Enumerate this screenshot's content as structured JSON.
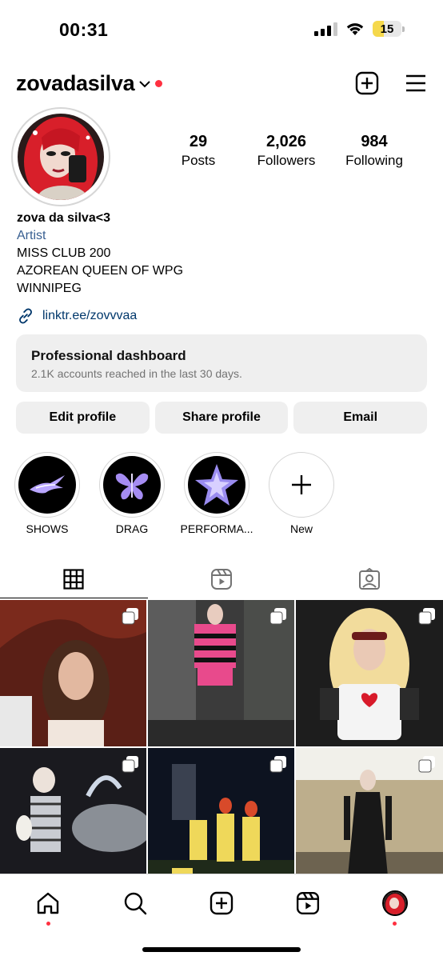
{
  "status_bar": {
    "time": "00:31",
    "battery": "15"
  },
  "header": {
    "username": "zovadasilva"
  },
  "profile": {
    "stats": [
      {
        "number": "29",
        "label": "Posts"
      },
      {
        "number": "2,026",
        "label": "Followers"
      },
      {
        "number": "984",
        "label": "Following"
      }
    ],
    "name": "zova da silva<3",
    "category": "Artist",
    "bio_lines": [
      "MISS CLUB 200",
      "AZOREAN QUEEN OF WPG",
      "WINNIPEG"
    ],
    "link": "linktr.ee/zovvvaa"
  },
  "dashboard": {
    "title": "Professional dashboard",
    "subtitle": "2.1K accounts reached in the last 30 days."
  },
  "buttons": {
    "edit": "Edit profile",
    "share": "Share profile",
    "email": "Email"
  },
  "highlights": [
    {
      "label": "SHOWS"
    },
    {
      "label": "DRAG"
    },
    {
      "label": "PERFORMA..."
    },
    {
      "label": "New"
    }
  ],
  "colors": {
    "accent_red": "#ff3040",
    "link_blue": "#00376b",
    "category_blue": "#385f91",
    "button_bg": "#efefef"
  },
  "icons": {
    "header": [
      "chevron-down-icon",
      "create-post-icon",
      "menu-icon"
    ],
    "tabs": [
      "grid-icon",
      "reels-icon",
      "tagged-icon"
    ],
    "nav": [
      "home-icon",
      "search-icon",
      "create-icon",
      "reels-icon",
      "profile-avatar"
    ]
  }
}
